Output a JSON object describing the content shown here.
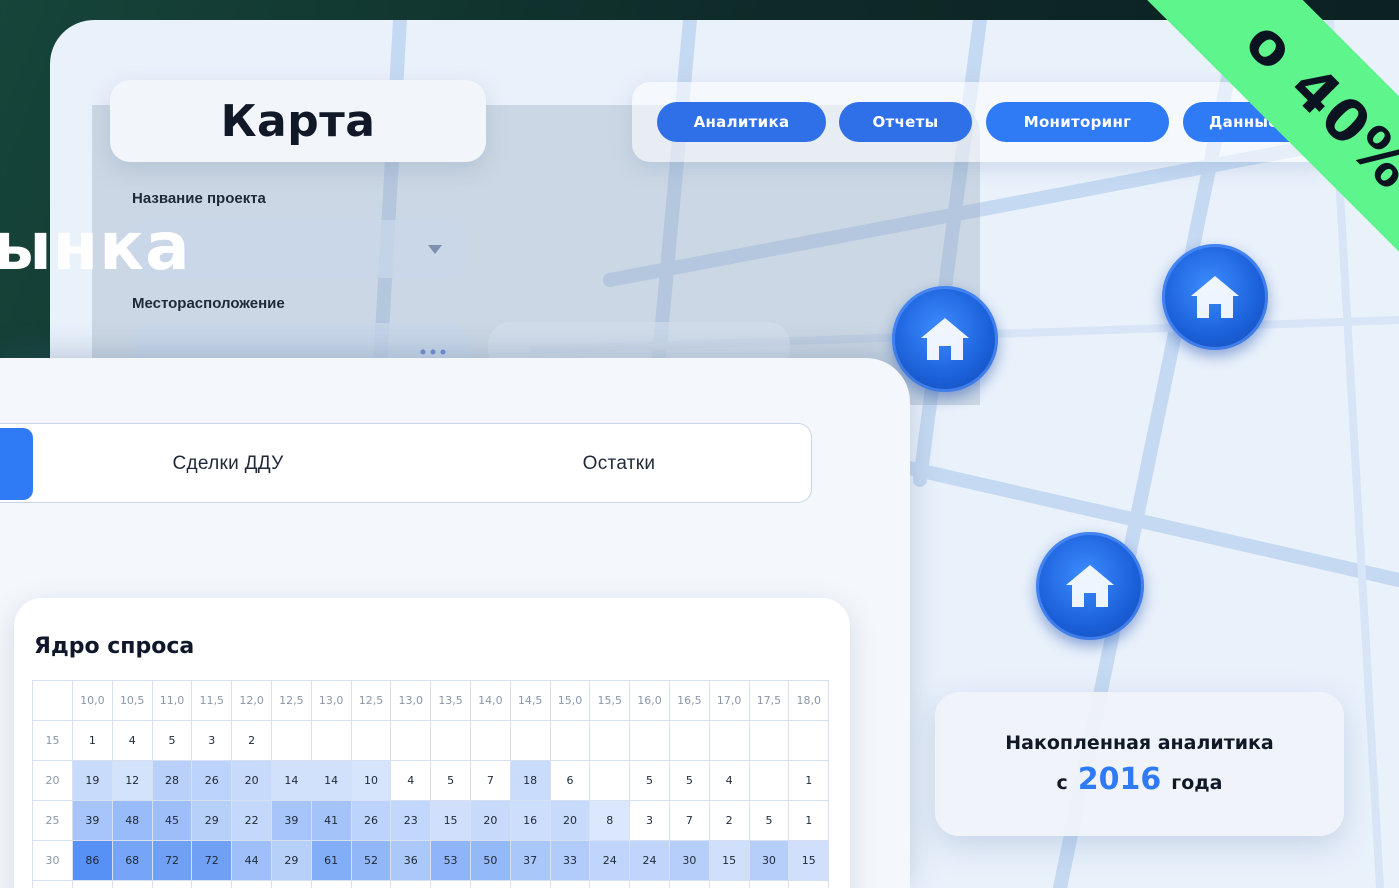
{
  "map_panel": {
    "title": "Карта",
    "fields": [
      {
        "label": "Название проекта",
        "value": ""
      },
      {
        "label": "Месторасположение",
        "value": ""
      }
    ],
    "nav": [
      "Аналитика",
      "Отчеты",
      "Мониторинг",
      "Данные"
    ],
    "analytics": {
      "line1": "Накопленная аналитика",
      "prefix": "с",
      "year": "2016",
      "suffix": "года"
    }
  },
  "big_word": "ынка",
  "ribbon_text": "о 40%",
  "tabs": [
    "Сделки ДДУ",
    "Остатки"
  ],
  "table": {
    "title": "Ядро спроса",
    "col_headers": [
      "10,0",
      "10,5",
      "11,0",
      "11,5",
      "12,0",
      "12,5",
      "13,0",
      "12,5",
      "13,0",
      "13,5",
      "14,0",
      "14,5",
      "15,0",
      "15,5",
      "16,0",
      "16,5",
      "17,0",
      "17,5",
      "18,0"
    ],
    "rows": [
      {
        "label": "15",
        "cells": [
          "1",
          "4",
          "5",
          "3",
          "2",
          "",
          "",
          "",
          "",
          "",
          "",
          "",
          "",
          "",
          "",
          "",
          "",
          "",
          ""
        ]
      },
      {
        "label": "20",
        "cells": [
          "19",
          "12",
          "28",
          "26",
          "20",
          "14",
          "14",
          "10",
          "4",
          "5",
          "7",
          "18",
          "6",
          "",
          "5",
          "5",
          "4",
          "",
          "1"
        ]
      },
      {
        "label": "25",
        "cells": [
          "39",
          "48",
          "45",
          "29",
          "22",
          "39",
          "41",
          "26",
          "23",
          "15",
          "20",
          "16",
          "20",
          "8",
          "3",
          "7",
          "2",
          "5",
          "1"
        ]
      },
      {
        "label": "30",
        "cells": [
          "86",
          "68",
          "72",
          "72",
          "44",
          "29",
          "61",
          "52",
          "36",
          "53",
          "50",
          "37",
          "33",
          "24",
          "24",
          "30",
          "15",
          "30",
          "15"
        ]
      },
      {
        "label": "",
        "cells": [
          "",
          "",
          "",
          "",
          "",
          "",
          "",
          "",
          "",
          "",
          "",
          "",
          "",
          "",
          "",
          "",
          "",
          "",
          ""
        ]
      }
    ]
  },
  "colors": {
    "accent": "#2f7bf5",
    "ribbon": "#5ef58d",
    "heat_max": "#3f84f2"
  }
}
